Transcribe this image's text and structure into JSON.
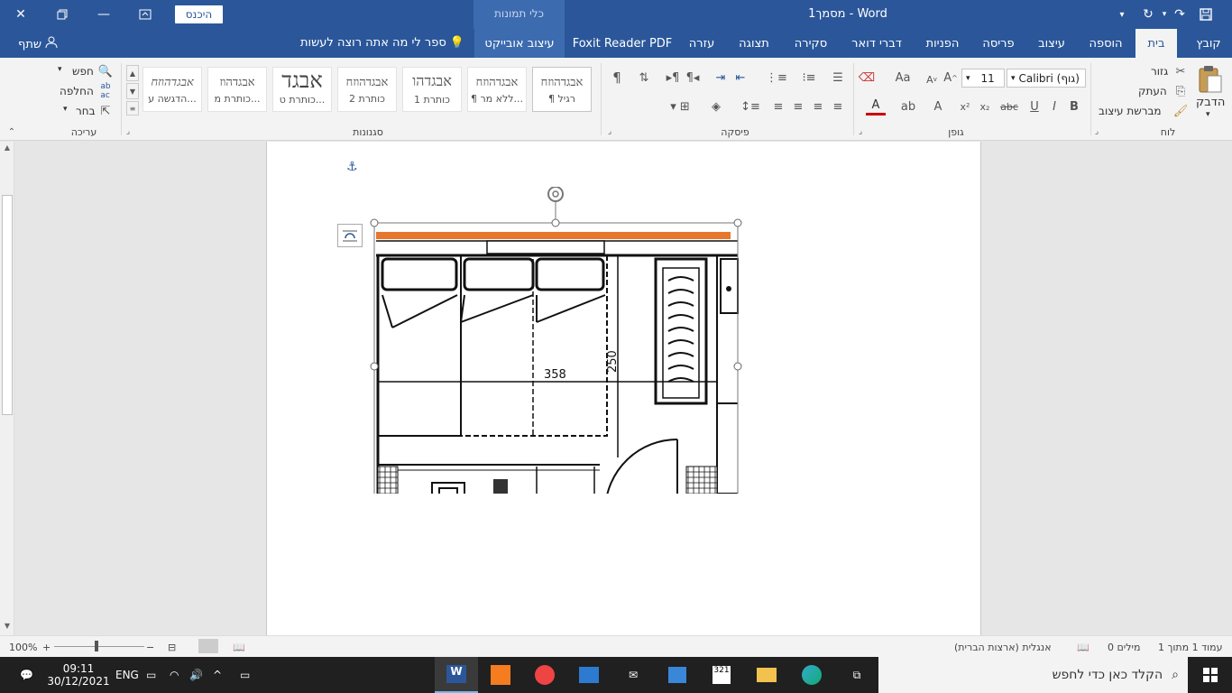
{
  "title_bar": {
    "doc_title": "מסמך1  -  Word",
    "context_group": "כלי תמונות",
    "signin_label": "היכנס"
  },
  "tabs": [
    {
      "label": "קובץ"
    },
    {
      "label": "בית"
    },
    {
      "label": "הוספה"
    },
    {
      "label": "עיצוב"
    },
    {
      "label": "פריסה"
    },
    {
      "label": "הפניות"
    },
    {
      "label": "דברי דואר"
    },
    {
      "label": "סקירה"
    },
    {
      "label": "תצוגה"
    },
    {
      "label": "עזרה"
    },
    {
      "label": "Foxit Reader PDF"
    },
    {
      "label": "עיצוב אובייקט"
    }
  ],
  "tell_me": "ספר לי מה אתה רוצה לעשות",
  "share_label": "שתף",
  "clipboard": {
    "paste_label": "הדבק",
    "cut_label": "גזור",
    "copy_label": "העתק",
    "format_painter_label": "מברשת עיצוב",
    "group_label": "לוח"
  },
  "font": {
    "font_name": "Calibri (גוף)",
    "font_size": "11",
    "bold": "B",
    "italic": "I",
    "underline": "U",
    "group_label": "גופן"
  },
  "paragraph": {
    "group_label": "פיסקה"
  },
  "styles": {
    "items": [
      {
        "sample": "אבגדהוזח",
        "name": "¶ רגיל"
      },
      {
        "sample": "אבגדהוזח",
        "name": "¶ ללא מר..."
      },
      {
        "sample": "אבגדהו",
        "name": "כותרת 1"
      },
      {
        "sample": "אבגדהוזח",
        "name": "כותרת 2"
      },
      {
        "sample": "אבגד",
        "name": "כותרת ט..."
      },
      {
        "sample": "אבגדהוז",
        "name": "כותרת מ..."
      },
      {
        "sample": "אבגדהוזח",
        "name": "הדגשה ע..."
      }
    ],
    "group_label": "סגנונות"
  },
  "editing": {
    "find_label": "חפש",
    "replace_label": "החלפה",
    "select_label": "בחר",
    "group_label": "עריכה"
  },
  "drawing": {
    "label_358": "358",
    "label_250": "250"
  },
  "status_bar": {
    "page_info": "עמוד 1 מתוך 1",
    "words": "0 מילים",
    "language": "אנגלית (ארצות הברית)",
    "zoom": "100%"
  },
  "taskbar": {
    "search_placeholder": "הקלד כאן כדי לחפש",
    "time": "09:11",
    "date": "30/12/2021",
    "lang": "ENG"
  },
  "colors": {
    "accent": "#2b579a",
    "ribbon": "#f3f3f3",
    "orange_bar": "#e8772e"
  }
}
